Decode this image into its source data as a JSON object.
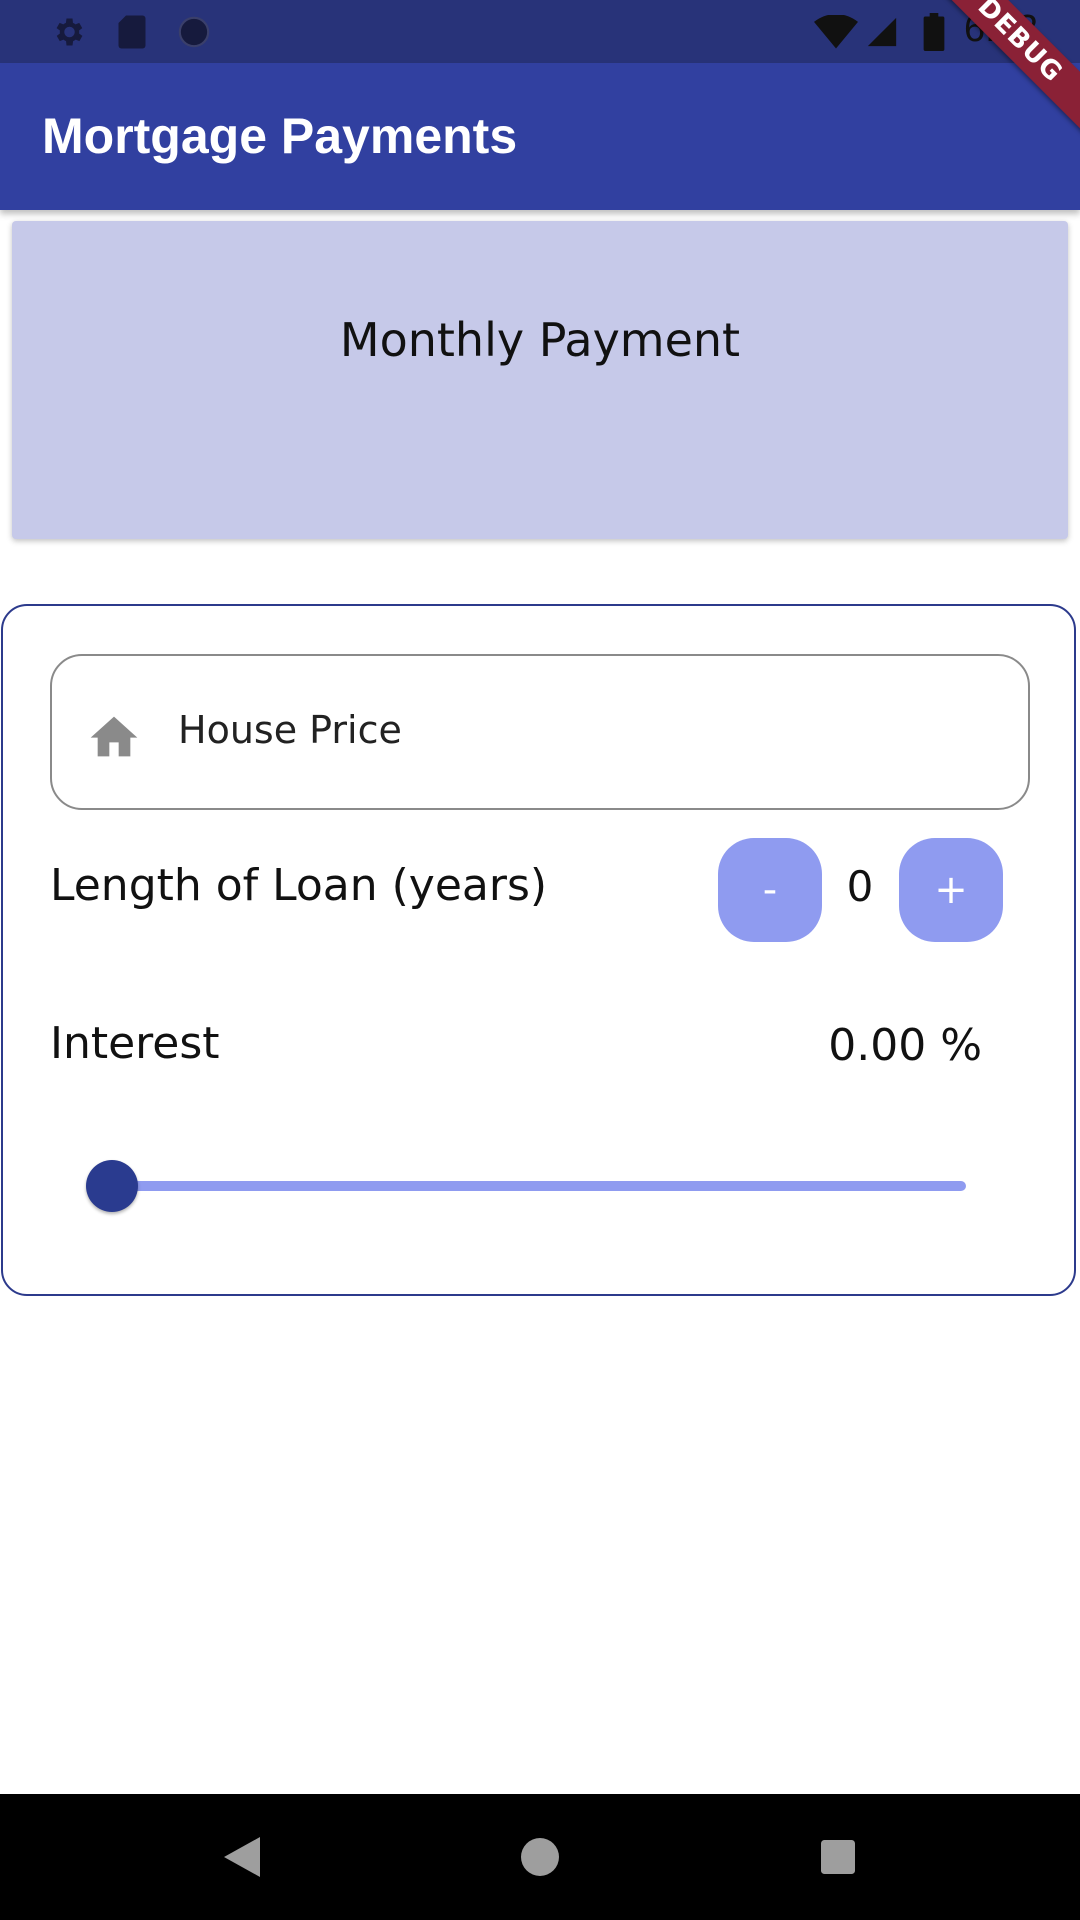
{
  "status_bar": {
    "time": "6:32",
    "icons_left": [
      "gear-icon",
      "sd-card-icon",
      "circle-icon"
    ],
    "icons_right": [
      "wifi-icon",
      "signal-icon",
      "battery-icon"
    ]
  },
  "debug_banner": "DEBUG",
  "app_bar": {
    "title": "Mortgage Payments",
    "color": "#3140a0"
  },
  "result_card": {
    "title": "Monthly Payment",
    "color": "#c6c9e9"
  },
  "form": {
    "house_price": {
      "placeholder": "House Price",
      "icon": "home-icon"
    },
    "loan_length": {
      "label": "Length of Loan (years)",
      "decrement_label": "-",
      "increment_label": "+",
      "value": "0"
    },
    "interest": {
      "label": "Interest",
      "value_text": "0.00 %",
      "slider_fraction": 0
    }
  },
  "nav_bar": {
    "buttons": [
      "back-icon",
      "home-circle-icon",
      "recents-icon"
    ]
  },
  "colors": {
    "primary": "#3140a0",
    "accent": "#8f9bf0",
    "slider_thumb": "#2a3b8f",
    "debug": "#8a2136"
  }
}
